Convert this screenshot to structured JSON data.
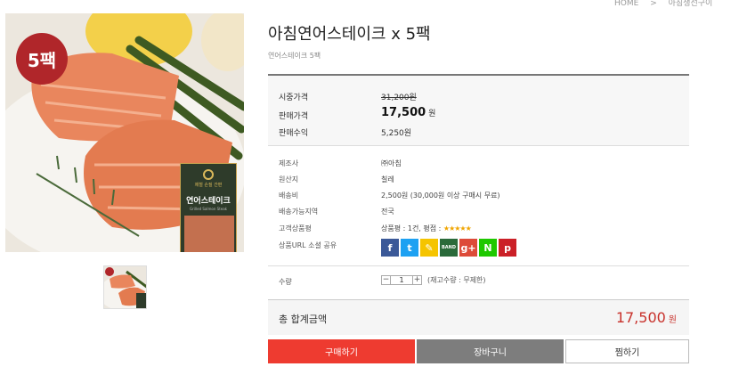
{
  "breadcrumb": {
    "home": "HOME",
    "sep": ">",
    "current": "아침생선구이"
  },
  "product": {
    "badge": "5팩",
    "package_tag": "제철 손질 간편",
    "package_name": "연어스테이크",
    "package_sub": "Grilled Salmon Steak",
    "title": "아침연어스테이크 x 5팩",
    "subtitle": "연어스테이크 5팩"
  },
  "prices": {
    "market_label": "시중가격",
    "market_value": "31,200원",
    "sale_label": "판매가격",
    "sale_value": "17,500",
    "sale_unit": "원",
    "profit_label": "판매수익",
    "profit_value": "5,250원"
  },
  "info": {
    "maker_label": "제조사",
    "maker_value": "㈜아침",
    "origin_label": "원산지",
    "origin_value": "칠레",
    "shipping_label": "배송비",
    "shipping_value": "2,500원 (30,000원 이상 구매시 무료)",
    "region_label": "배송가능지역",
    "region_value": "전국",
    "review_label": "고객상품평",
    "review_value": "상품평 : 1건, 평점 : ",
    "review_stars": "★★★★★",
    "share_label": "상품URL 소셜 공유"
  },
  "share_icons": [
    {
      "name": "facebook-icon",
      "glyph": "f",
      "color": "#3b5998"
    },
    {
      "name": "twitter-icon",
      "glyph": "t",
      "color": "#1da1f2"
    },
    {
      "name": "kakaostory-icon",
      "glyph": "✎",
      "color": "#f5c400"
    },
    {
      "name": "band-icon",
      "glyph": "B",
      "color": "#2a6a3a"
    },
    {
      "name": "googleplus-icon",
      "glyph": "g+",
      "color": "#dd4b39"
    },
    {
      "name": "naver-icon",
      "glyph": "N",
      "color": "#1ec800"
    },
    {
      "name": "pinterest-icon",
      "glyph": "p",
      "color": "#cb2027"
    }
  ],
  "band_text": "BAND",
  "quantity": {
    "label": "수량",
    "minus": "−",
    "value": "1",
    "plus": "+",
    "stock": "(재고수량 : 무제한)"
  },
  "total": {
    "label": "총 합계금액",
    "value": "17,500",
    "unit": "원"
  },
  "buttons": {
    "buy": "구매하기",
    "cart": "장바구니",
    "wish": "찜하기"
  },
  "colors": {
    "accent": "#c8312b",
    "buy_bg": "#ee3b30",
    "cart_bg": "#7d7d7d"
  }
}
